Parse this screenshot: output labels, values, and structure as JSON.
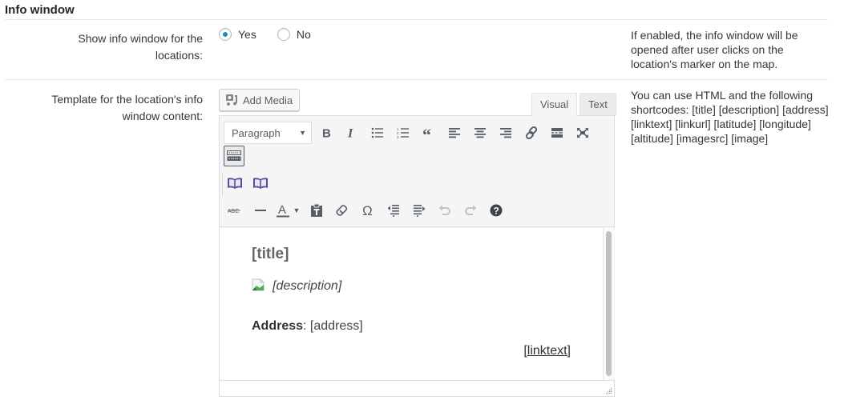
{
  "section": {
    "title": "Info window"
  },
  "rows": [
    {
      "label": "Show info window for the locations:",
      "description": "If enabled, the info window will be opened after user clicks on the location's marker on the map.",
      "options": [
        {
          "label": "Yes",
          "checked": true
        },
        {
          "label": "No",
          "checked": false
        }
      ]
    },
    {
      "label": "Template for the location's info window content:",
      "description": "You can use HTML and the following shortcodes: [title] [description] [address] [linktext] [linkurl] [latitude] [longitude] [altitude] [imagesrc] [image]"
    }
  ],
  "editor": {
    "add_media_label": "Add Media",
    "tabs": {
      "visual": "Visual",
      "text": "Text",
      "active": "Visual"
    },
    "format_select": "Paragraph",
    "toolbar_row1": [
      "bold-icon",
      "italic-icon",
      "bullet-list-icon",
      "numbered-list-icon",
      "blockquote-icon",
      "align-left-icon",
      "align-center-icon",
      "align-right-icon",
      "link-icon",
      "read-more-icon",
      "fullscreen-icon"
    ],
    "toolbar_row2": [
      "toolbar-toggle-icon"
    ],
    "toolbar_row3": [
      "book-icon",
      "book-icon"
    ],
    "toolbar_row4": [
      "strikethrough-icon",
      "horizontal-line-icon",
      "text-color-icon",
      "paste-text-icon",
      "clear-formatting-icon",
      "special-character-icon",
      "outdent-icon",
      "indent-icon",
      "undo-icon",
      "redo-icon",
      "help-icon"
    ],
    "content": {
      "title": "[title]",
      "description": "[description]",
      "address_label": "Address",
      "address_sep": ": ",
      "address_value": "[address]",
      "link_text": "[linktext]"
    }
  },
  "colors": {
    "radio_accent": "#1e8cbe",
    "icon": "#555d66",
    "book_icon": "#5b4d9c"
  }
}
